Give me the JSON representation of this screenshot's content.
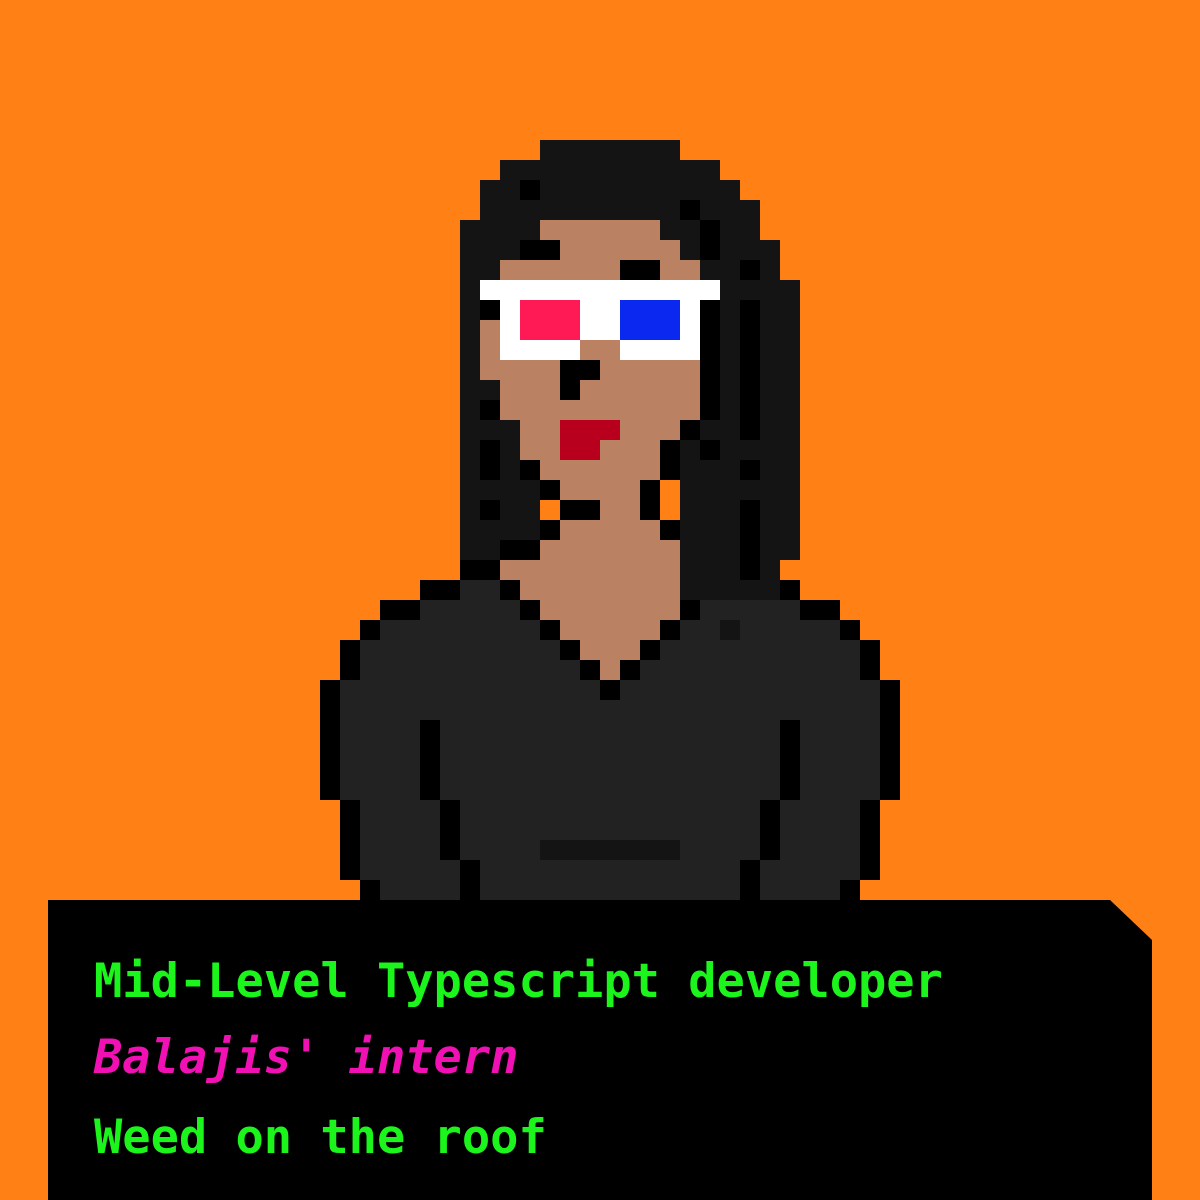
{
  "caption": {
    "role": "Mid-Level Typescript developer",
    "affiliation": "Balajis' intern",
    "trait": "Weed on the roof"
  },
  "portrait": {
    "subject": "pixel-art woman with long black hair wearing anaglyph 3D glasses",
    "accessories": [
      "3d-glasses-icon"
    ],
    "clothing": "black hoodie"
  },
  "colors": {
    "background": "#FF8115",
    "panel": "#000000",
    "primary_text": "#1BF51B",
    "accent_text": "#F010B4",
    "skin": "#BA8262",
    "hair": "#141414",
    "hoodie": "#222222",
    "outline": "#000000",
    "lips": "#B8001E",
    "glasses_frame": "#FFFFFF",
    "lens_red": "#FF1A55",
    "lens_blue": "#0A28F0"
  }
}
